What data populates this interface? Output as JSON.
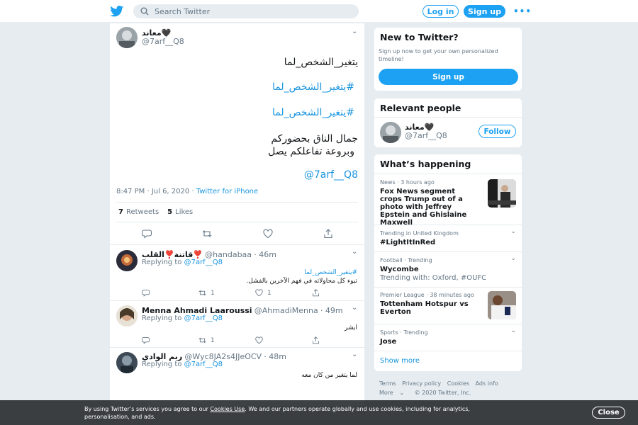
{
  "header": {
    "search_placeholder": "Search Twitter",
    "login_label": "Log in",
    "signup_label": "Sign up",
    "more_label": "•••"
  },
  "tweet": {
    "author_name": "معاند🖤",
    "author_handle": "@7arf__Q8",
    "line1": "يتغير_الشخص_لما",
    "hashtag1": "#يتغير_الشخص_لما",
    "hashtag2": "#يتغير_الشخص_لما",
    "line4": "جمال الناق بحضوركم",
    "line5": "وبروعة تفاعلكم يصل",
    "mention": "@7arf__Q8",
    "time": "8:47 PM · Jul 6, 2020",
    "source": "Twitter for iPhone",
    "retweets_count": "7",
    "retweets_label": "Retweets",
    "likes_count": "5",
    "likes_label": "Likes"
  },
  "replies": [
    {
      "name": "قاتنة❣️القلب❣️",
      "handle": "@handabaa",
      "time": "· 46m",
      "replying_label": "Replying to",
      "replying_to": "@7arf__Q8",
      "hashtag": "#يتغير_الشخص_لما",
      "text": "تبوء كل محاولاته في فهم الآخرين بالفشل.",
      "retweets": "1",
      "likes": "1"
    },
    {
      "name": "Menna Ahmadi Laaroussi",
      "handle": "@AhmadiMenna",
      "time": "· 49m",
      "replying_label": "Replying to",
      "replying_to": "@7arf__Q8",
      "text": "ابشر",
      "retweets": "1",
      "likes": ""
    },
    {
      "name": "ريم الوادي",
      "handle": "@Wyc8JA2s4JJeOCV",
      "time": "· 48m",
      "replying_label": "Replying to",
      "replying_to": "@7arf__Q8",
      "text": "لما يتغير من كان معه",
      "retweets": "",
      "likes": ""
    }
  ],
  "new_to_twitter": {
    "title": "New to Twitter?",
    "text": "Sign up now to get your own personalized timeline!",
    "button": "Sign up"
  },
  "relevant_people": {
    "title": "Relevant people",
    "name": "معاند🖤",
    "handle": "@7arf__Q8",
    "follow_label": "Follow"
  },
  "whats_happening": {
    "title": "What’s happening",
    "trends": [
      {
        "meta": "News · 3 hours ago",
        "title": "Fox News segment crops Trump out of a photo with Jeffrey Epstein and Ghislaine Maxwell"
      },
      {
        "meta": "Trending in United Kingdom",
        "title": "#LightItInRed"
      },
      {
        "meta": "Football · Trending",
        "title": "Wycombe",
        "sub": "Trending with: Oxford, #OUFC"
      },
      {
        "meta": "Premier League · 38 minutes ago",
        "title": "Tottenham Hotspur vs Everton"
      },
      {
        "meta": "Sports · Trending",
        "title": "Jose"
      }
    ],
    "show_more": "Show more"
  },
  "footer": {
    "terms": "Terms",
    "privacy": "Privacy policy",
    "cookies": "Cookies",
    "ads": "Ads info",
    "more": "More",
    "copyright": "© 2020 Twitter, Inc."
  },
  "cookie_banner": {
    "text_before": "By using Twitter’s services you agree to our",
    "link": "Cookies Use",
    "text_after": ". We and our partners operate globally and use cookies, including for analytics, personalisation, and ads.",
    "close": "Close"
  },
  "colors": {
    "brand_blue": "#1da1f2",
    "link_blue": "#1b95e0",
    "background": "#e6ecf0"
  }
}
